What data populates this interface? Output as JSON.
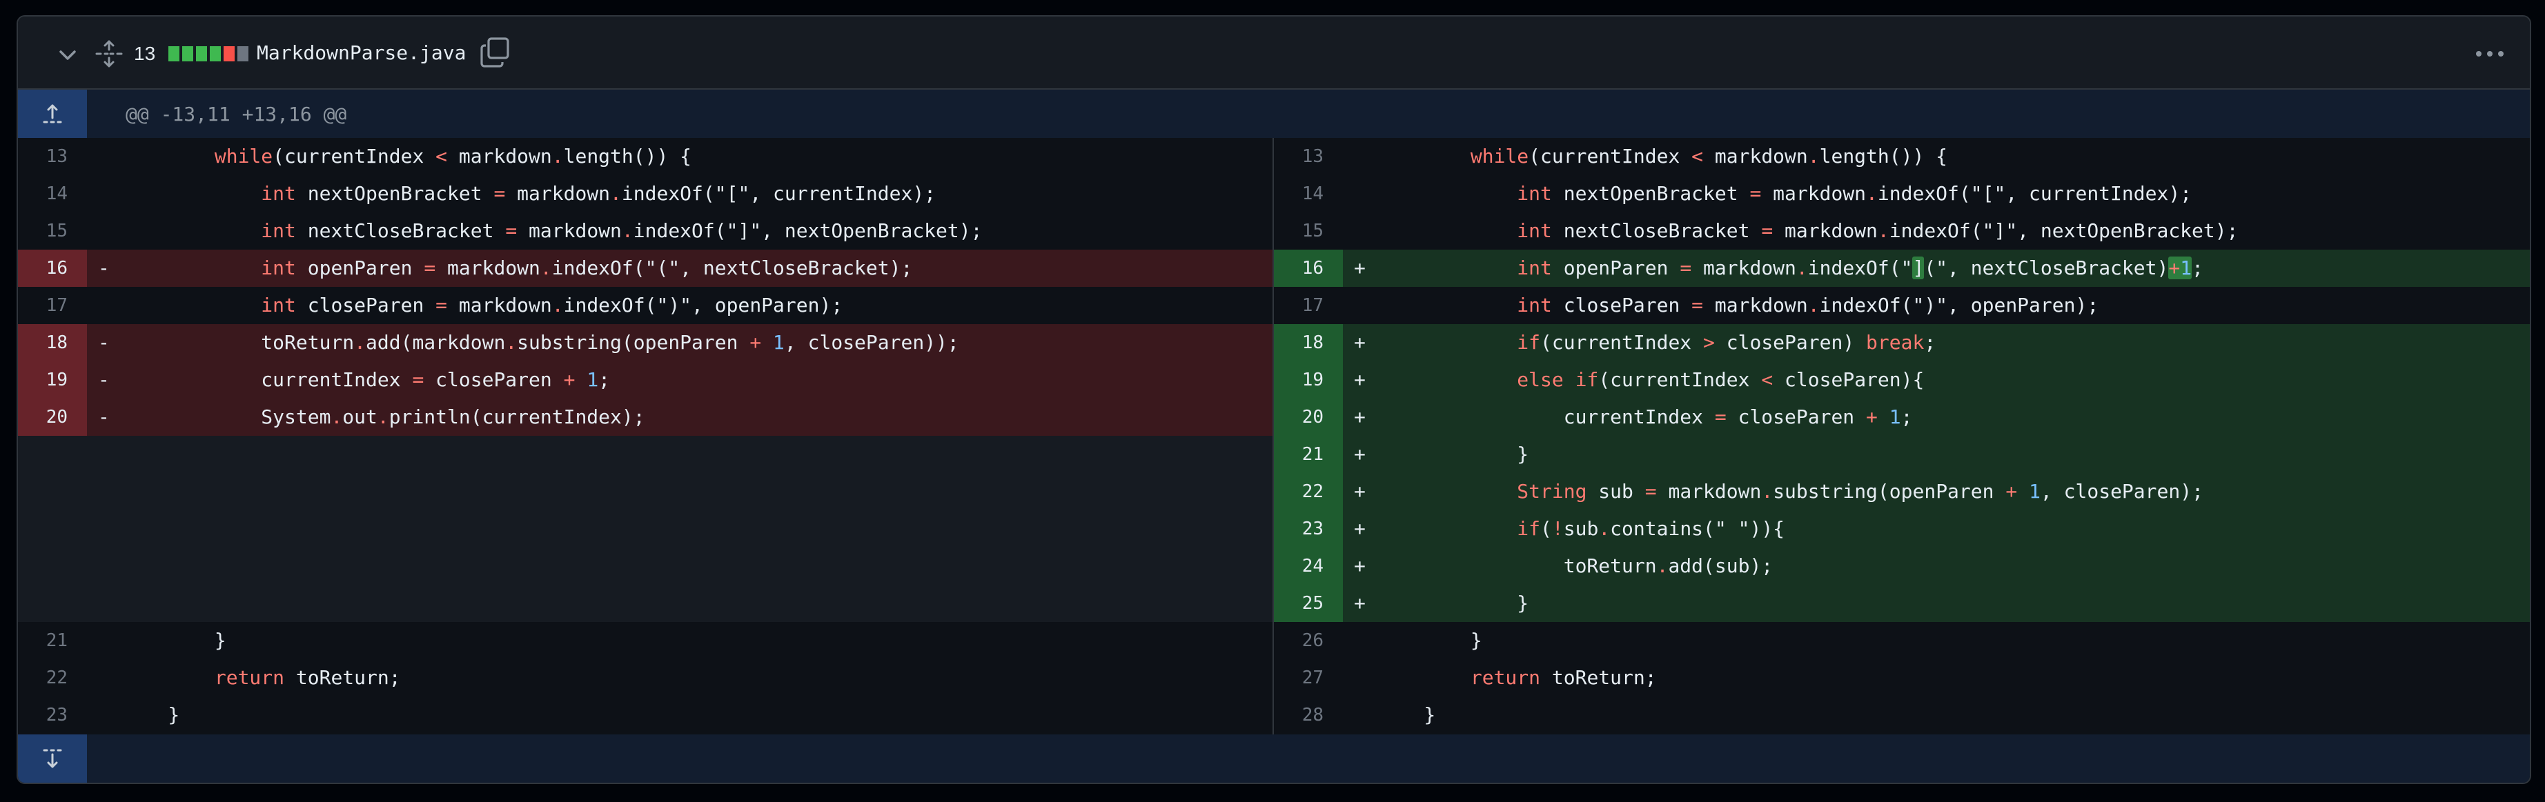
{
  "file": {
    "change_count": "13",
    "filename": "MarkdownParse.java",
    "diffstat_colors": [
      "#3fb950",
      "#3fb950",
      "#3fb950",
      "#3fb950",
      "#f85149",
      "#6e7681"
    ],
    "hunk_header": "@@ -13,11 +13,16 @@",
    "icons": {
      "collapse": "chevron-down-icon",
      "expand": "unfold-icon",
      "copy": "copy-icon",
      "more": "kebab-horizontal-icon",
      "expand_up": "expand-up-icon",
      "expand_down": "expand-down-icon"
    }
  },
  "colors": {
    "deleted_line": "#3a181d",
    "deleted_gutter": "#67232a",
    "added_line": "#173322",
    "added_gutter": "#1e5c2f",
    "keyword": "#ff7b72",
    "number": "#79c0ff"
  },
  "left": {
    "rows": [
      {
        "num": "13",
        "marker": "",
        "code": "        while(currentIndex < markdown.length()) {"
      },
      {
        "num": "14",
        "marker": "",
        "code": "            int nextOpenBracket = markdown.indexOf(\"[\", currentIndex);"
      },
      {
        "num": "15",
        "marker": "",
        "code": "            int nextCloseBracket = markdown.indexOf(\"]\", nextOpenBracket);"
      },
      {
        "num": "16",
        "marker": "-",
        "code": "            int openParen = markdown.indexOf(\"(\", nextCloseBracket);"
      },
      {
        "num": "17",
        "marker": "",
        "code": "            int closeParen = markdown.indexOf(\")\", openParen);"
      },
      {
        "num": "18",
        "marker": "-",
        "code": "            toReturn.add(markdown.substring(openParen + 1, closeParen));"
      },
      {
        "num": "19",
        "marker": "-",
        "code": "            currentIndex = closeParen + 1;"
      },
      {
        "num": "20",
        "marker": "-",
        "code": "            System.out.println(currentIndex);"
      },
      {
        "num": "21",
        "marker": "",
        "code": "        }"
      },
      {
        "num": "22",
        "marker": "",
        "code": "        return toReturn;"
      },
      {
        "num": "23",
        "marker": "",
        "code": "    }"
      }
    ]
  },
  "right": {
    "rows": [
      {
        "num": "13",
        "marker": "",
        "code": "        while(currentIndex < markdown.length()) {"
      },
      {
        "num": "14",
        "marker": "",
        "code": "            int nextOpenBracket = markdown.indexOf(\"[\", currentIndex);"
      },
      {
        "num": "15",
        "marker": "",
        "code": "            int nextCloseBracket = markdown.indexOf(\"]\", nextOpenBracket);"
      },
      {
        "num": "16",
        "marker": "+",
        "code": "            int openParen = markdown.indexOf(\"](\", nextCloseBracket)+1;"
      },
      {
        "num": "17",
        "marker": "",
        "code": "            int closeParen = markdown.indexOf(\")\", openParen);"
      },
      {
        "num": "18",
        "marker": "+",
        "code": "            if(currentIndex > closeParen) break;"
      },
      {
        "num": "19",
        "marker": "+",
        "code": "            else if(currentIndex < closeParen){"
      },
      {
        "num": "20",
        "marker": "+",
        "code": "                currentIndex = closeParen + 1;"
      },
      {
        "num": "21",
        "marker": "+",
        "code": "            }"
      },
      {
        "num": "22",
        "marker": "+",
        "code": "            String sub = markdown.substring(openParen + 1, closeParen);"
      },
      {
        "num": "23",
        "marker": "+",
        "code": "            if(!sub.contains(\" \")){"
      },
      {
        "num": "24",
        "marker": "+",
        "code": "                toReturn.add(sub);"
      },
      {
        "num": "25",
        "marker": "+",
        "code": "            }"
      },
      {
        "num": "26",
        "marker": "",
        "code": "        }"
      },
      {
        "num": "27",
        "marker": "",
        "code": "        return toReturn;"
      },
      {
        "num": "28",
        "marker": "",
        "code": "    }"
      }
    ]
  }
}
